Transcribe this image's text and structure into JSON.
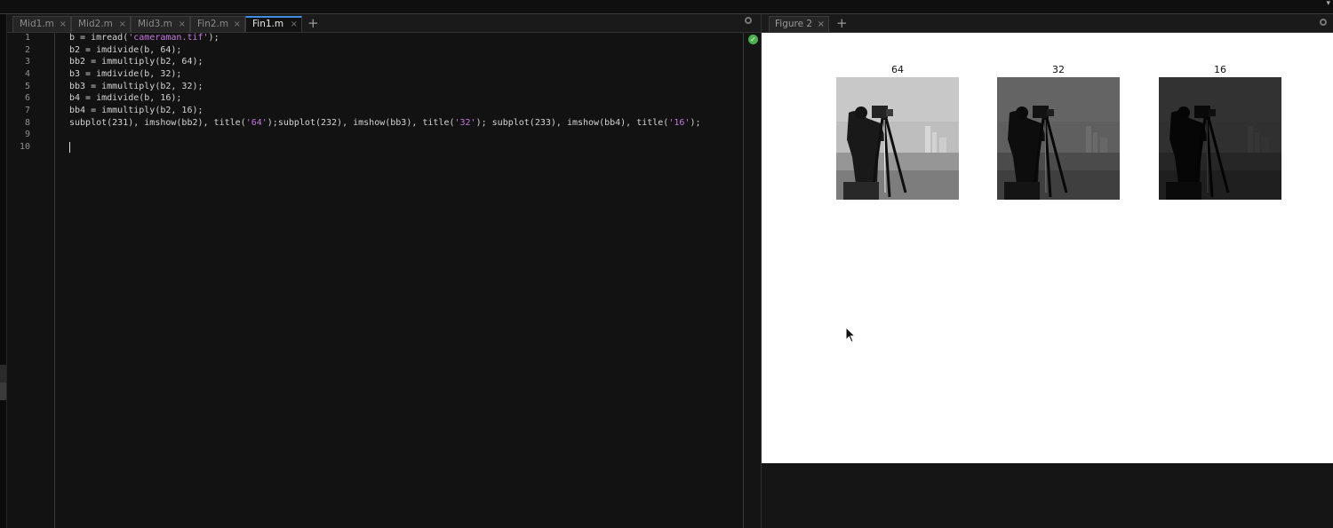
{
  "editor": {
    "tabs": [
      {
        "label": "Mid1.m",
        "active": false
      },
      {
        "label": "Mid2.m",
        "active": false
      },
      {
        "label": "Mid3.m",
        "active": false
      },
      {
        "label": "Fin2.m",
        "active": false
      },
      {
        "label": "Fin1.m",
        "active": true
      }
    ],
    "close_glyph": "×",
    "add_glyph": "+",
    "lines": [
      {
        "num": "1",
        "code": "b = imread('cameraman.tif');"
      },
      {
        "num": "2",
        "code": "b2 = imdivide(b, 64);"
      },
      {
        "num": "3",
        "code": "bb2 = immultiply(b2, 64);"
      },
      {
        "num": "4",
        "code": "b3 = imdivide(b, 32);"
      },
      {
        "num": "5",
        "code": "bb3 = immultiply(b2, 32);"
      },
      {
        "num": "6",
        "code": "b4 = imdivide(b, 16);"
      },
      {
        "num": "7",
        "code": "bb4 = immultiply(b2, 16);"
      },
      {
        "num": "8",
        "code": "subplot(231), imshow(bb2), title('64');subplot(232), imshow(bb3), title('32'); subplot(233), imshow(bb4), title('16');"
      },
      {
        "num": "9",
        "code": ""
      },
      {
        "num": "10",
        "code": ""
      }
    ],
    "status_icon": "check-circle-icon",
    "string_color": "#c678dd"
  },
  "figure": {
    "tab_label": "Figure 2",
    "close_glyph": "×",
    "add_glyph": "+",
    "subplots": [
      {
        "title": "64",
        "brightness": 1.0
      },
      {
        "title": "32",
        "brightness": 0.5
      },
      {
        "title": "16",
        "brightness": 0.25
      }
    ]
  }
}
